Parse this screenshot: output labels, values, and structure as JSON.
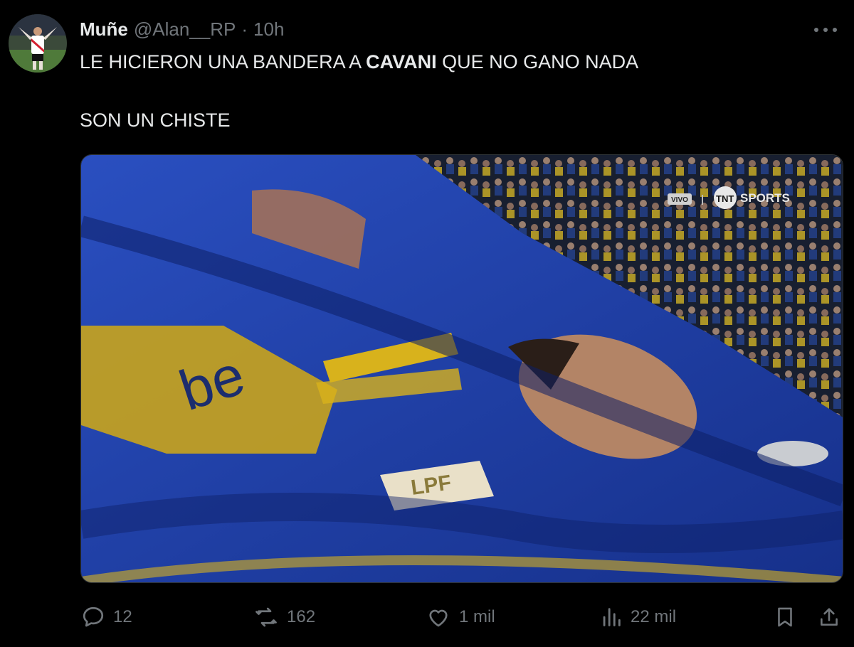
{
  "author": {
    "name": "Muñe",
    "handle": "@Alan__RP",
    "separator": "·",
    "time": "10h"
  },
  "tweet": {
    "line1_pre": "LE HICIERON UNA BANDERA A ",
    "line1_bold": "CAVANI",
    "line1_post": " QUE NO GANO NADA",
    "line2": "SON UN CHISTE"
  },
  "media": {
    "live_badge": "VIVO",
    "broadcaster": "SPORTS",
    "broadcaster_logo": "TNT",
    "jersey_text": "be",
    "badge_text": "LPF"
  },
  "actions": {
    "replies": "12",
    "reposts": "162",
    "likes": "1 mil",
    "views": "22 mil"
  },
  "colors": {
    "background": "#000000",
    "text": "#e7e9ea",
    "secondary": "#71767b",
    "boca_blue": "#1e3ea8",
    "boca_gold": "#d8b21c"
  },
  "icons": [
    "more-icon",
    "reply-icon",
    "repost-icon",
    "like-icon",
    "views-icon",
    "bookmark-icon",
    "share-icon"
  ]
}
